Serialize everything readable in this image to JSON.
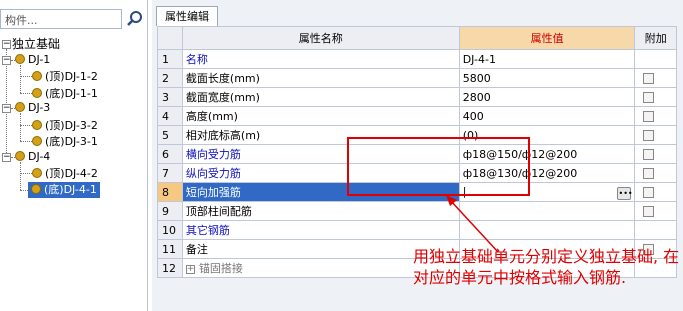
{
  "search": {
    "placeholder": "构件..."
  },
  "tree": {
    "root": "独立基础",
    "groups": [
      {
        "label": "DJ-1",
        "children": [
          "(顶)DJ-1-2",
          "(底)DJ-1-1"
        ]
      },
      {
        "label": "DJ-3",
        "children": [
          "(顶)DJ-3-2",
          "(底)DJ-3-1"
        ]
      },
      {
        "label": "DJ-4",
        "children": [
          "(顶)DJ-4-2",
          "(底)DJ-4-1"
        ]
      }
    ],
    "selected": "(底)DJ-4-1"
  },
  "tab": {
    "label": "属性编辑"
  },
  "grid": {
    "headers": {
      "name": "属性名称",
      "value": "属性值",
      "extra": "附加"
    },
    "rows": [
      {
        "num": "1",
        "name": "名称",
        "value": "DJ-4-1",
        "blue": true,
        "checkbox": false
      },
      {
        "num": "2",
        "name": "截面长度(mm)",
        "value": "5800",
        "blue": false,
        "checkbox": true
      },
      {
        "num": "3",
        "name": "截面宽度(mm)",
        "value": "2800",
        "blue": false,
        "checkbox": true
      },
      {
        "num": "4",
        "name": "高度(mm)",
        "value": "400",
        "blue": false,
        "checkbox": true
      },
      {
        "num": "5",
        "name": "相对底标高(m)",
        "value": "(0)",
        "blue": false,
        "checkbox": true
      },
      {
        "num": "6",
        "name": "横向受力筋",
        "value": "ф18@150/ф12@200",
        "blue": true,
        "checkbox": true
      },
      {
        "num": "7",
        "name": "纵向受力筋",
        "value": "ф18@130/ф12@200",
        "blue": true,
        "checkbox": true
      },
      {
        "num": "8",
        "name": "短向加强筋",
        "value": "",
        "blue": true,
        "checkbox": true
      },
      {
        "num": "9",
        "name": "顶部柱间配筋",
        "value": "",
        "blue": false,
        "checkbox": true
      },
      {
        "num": "10",
        "name": "其它钢筋",
        "value": "",
        "blue": true,
        "checkbox": false
      },
      {
        "num": "11",
        "name": "备注",
        "value": "",
        "blue": false,
        "checkbox": true
      },
      {
        "num": "12",
        "name": "锚固搭接",
        "value": "",
        "blue": false,
        "checkbox": false
      }
    ]
  },
  "annotation": "用独立基础单元分别定义独立基础, 在对应的单元中按格式输入钢筋.",
  "colors": {
    "accent": "#e00000",
    "selection": "#3169c6",
    "label_blue": "#1010c0"
  }
}
